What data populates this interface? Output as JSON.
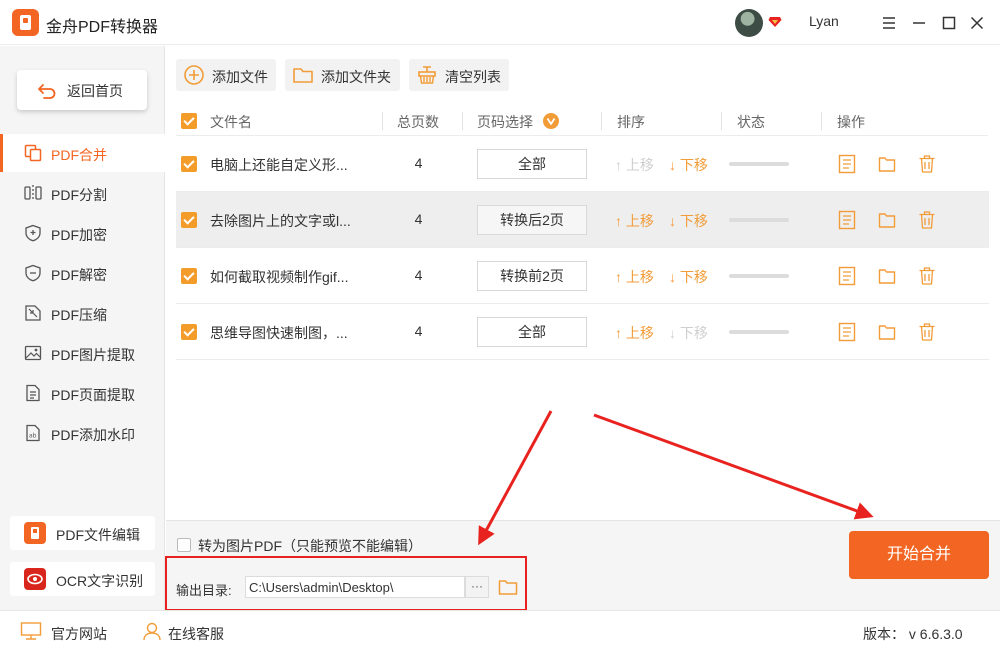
{
  "app": {
    "title": "金舟PDF转换器",
    "username": "Lyan"
  },
  "sidebar": {
    "home": "返回首页",
    "items": [
      {
        "label": "PDF合并",
        "icon": "merge-icon",
        "active": true
      },
      {
        "label": "PDF分割",
        "icon": "split-icon"
      },
      {
        "label": "PDF加密",
        "icon": "lock-shield-icon"
      },
      {
        "label": "PDF解密",
        "icon": "unlock-shield-icon"
      },
      {
        "label": "PDF压缩",
        "icon": "compress-icon"
      },
      {
        "label": "PDF图片提取",
        "icon": "image-icon"
      },
      {
        "label": "PDF页面提取",
        "icon": "page-icon"
      },
      {
        "label": "PDF添加水印",
        "icon": "watermark-icon"
      }
    ],
    "tools": [
      {
        "label": "PDF文件编辑",
        "icon": "pdf-edit-icon",
        "color": "#f26522"
      },
      {
        "label": "OCR文字识别",
        "icon": "ocr-eye-icon",
        "color": "#d9261c"
      }
    ]
  },
  "toolbar": {
    "add_file": "添加文件",
    "add_folder": "添加文件夹",
    "clear_list": "清空列表"
  },
  "table": {
    "headers": {
      "name": "文件名",
      "pages": "总页数",
      "page_select": "页码选择",
      "order": "排序",
      "status": "状态",
      "actions": "操作"
    },
    "move_up": "上移",
    "move_down": "下移",
    "rows": [
      {
        "name": "电脑上还能自定义形...",
        "pages": "4",
        "selection": "全部",
        "up_enabled": false,
        "down_enabled": true
      },
      {
        "name": "去除图片上的文字或l...",
        "pages": "4",
        "selection": "转换后2页",
        "up_enabled": true,
        "down_enabled": true
      },
      {
        "name": "如何截取视频制作gif...",
        "pages": "4",
        "selection": "转换前2页",
        "up_enabled": true,
        "down_enabled": true
      },
      {
        "name": "思维导图快速制图，...",
        "pages": "4",
        "selection": "全部",
        "up_enabled": true,
        "down_enabled": false
      }
    ]
  },
  "bottom": {
    "convert_image_pdf": "转为图片PDF（只能预览不能编辑）",
    "output_label": "输出目录:",
    "output_path": "C:\\Users\\admin\\Desktop\\",
    "browse": "···",
    "start": "开始合并"
  },
  "status_bar": {
    "website": "官方网站",
    "support": "在线客服",
    "version": "版本：  v 6.6.3.0"
  },
  "colors": {
    "accent": "#f26522",
    "checkbox": "#f49c2a",
    "annotation": "#e8231f"
  }
}
